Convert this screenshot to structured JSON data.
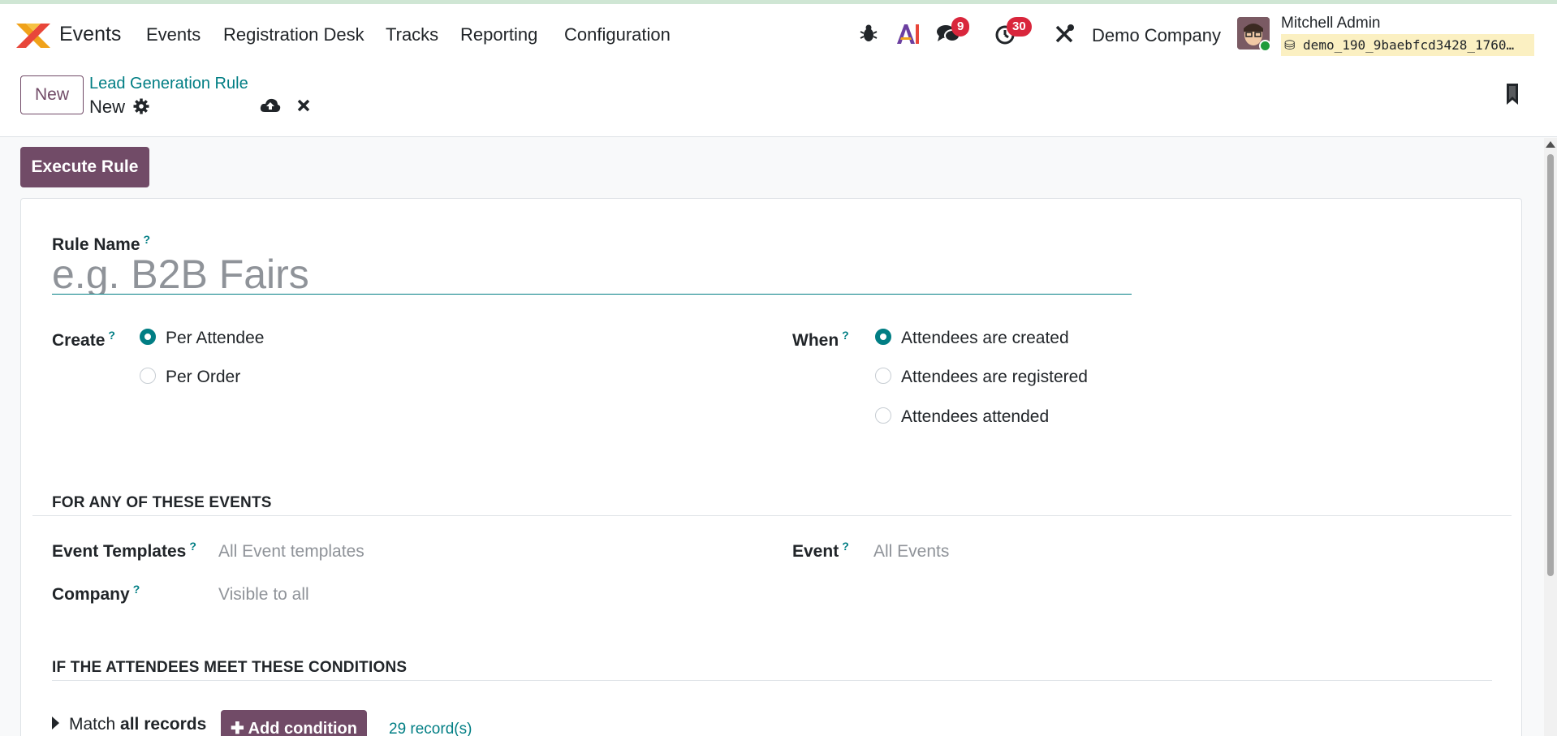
{
  "navbar": {
    "app_name": "Events",
    "menu": [
      "Events",
      "Registration Desk",
      "Tracks",
      "Reporting",
      "Configuration"
    ],
    "messages_count": "9",
    "activities_count": "30",
    "company": "Demo Company",
    "user_name": "Mitchell Admin",
    "db_name": "demo_190_9baebfcd3428_1760…",
    "icons": [
      "bug-icon",
      "ai-icon",
      "chat-icon",
      "clock-icon",
      "tools-icon",
      "database-icon"
    ]
  },
  "control": {
    "new_label": "New",
    "breadcrumb_parent": "Lead Generation Rule",
    "breadcrumb_current": "New"
  },
  "toolbar": {
    "execute_label": "Execute Rule"
  },
  "form": {
    "rule_name_label": "Rule Name",
    "rule_name_placeholder": "e.g. B2B Fairs",
    "help": "?",
    "create_label": "Create",
    "create_options": [
      "Per Attendee",
      "Per Order"
    ],
    "when_label": "When",
    "when_options": [
      "Attendees are created",
      "Attendees are registered",
      "Attendees attended"
    ],
    "section_events": "FOR ANY OF THESE EVENTS",
    "event_templates_label": "Event Templates",
    "event_templates_placeholder": "All Event templates",
    "event_label": "Event",
    "event_placeholder": "All Events",
    "company_label": "Company",
    "company_placeholder": "Visible to all",
    "section_conditions": "IF THE ATTENDEES MEET THESE CONDITIONS",
    "match_prefix": "Match",
    "match_strong": "all records",
    "add_condition": "Add condition",
    "records_count": "29 record(s)"
  },
  "colors": {
    "primary": "#714b67",
    "accent": "#017e84",
    "badge": "#d9263c"
  }
}
